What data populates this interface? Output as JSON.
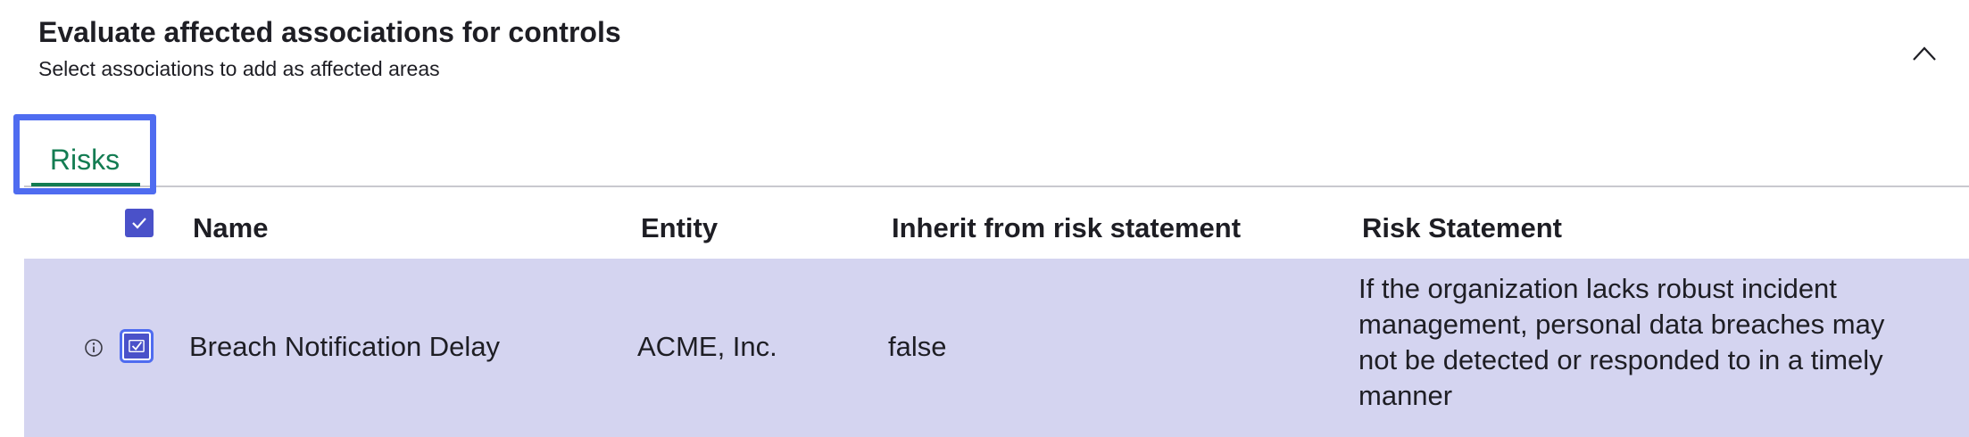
{
  "section": {
    "title": "Evaluate affected associations for controls",
    "subtitle": "Select associations to add as affected areas",
    "collapse_icon": "chevron-up-icon"
  },
  "tabs": [
    {
      "label": "Risks",
      "active": true
    }
  ],
  "table": {
    "columns": [
      "Name",
      "Entity",
      "Inherit from risk statement",
      "Risk Statement"
    ],
    "select_all_checked": true,
    "rows": [
      {
        "checked": true,
        "name": "Breach Notification Delay",
        "entity": "ACME, Inc.",
        "inherit": "false",
        "risk_statement": "If the organization lacks robust incident management, personal data breaches may not be detected or responded to in a timely manner"
      }
    ]
  },
  "colors": {
    "accent": "#4a51c9",
    "tab_active": "#137c52",
    "focus_ring": "#4f6cf0",
    "selected_row": "#d4d4f0"
  }
}
